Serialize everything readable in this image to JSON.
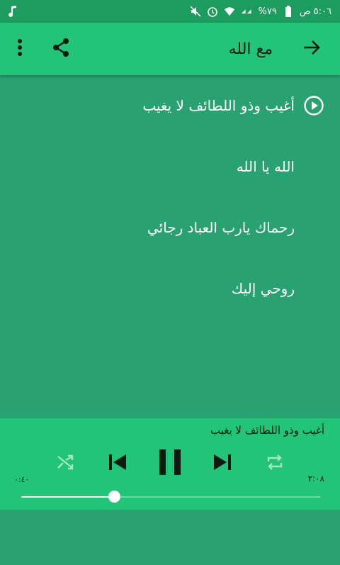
{
  "status_bar": {
    "time": "٥:٠٦ ص",
    "battery": "%٧٩",
    "icons": [
      "music-note-icon",
      "mute-icon",
      "alarm-icon",
      "wifi-icon",
      "signal-icon",
      "battery-icon"
    ]
  },
  "app_bar": {
    "title": "مع الله",
    "icons": [
      "overflow-menu-icon",
      "share-icon",
      "arrow-forward-icon"
    ]
  },
  "tracks": [
    {
      "title": "أغيب وذو اللطائف لا يغيب",
      "playing": true
    },
    {
      "title": "الله يا الله",
      "playing": false
    },
    {
      "title": "رحماك يارب العباد رجائي",
      "playing": false
    },
    {
      "title": "روحي إليك",
      "playing": false
    }
  ],
  "player": {
    "now_playing": "أغيب وذو اللطائف لا يغيب",
    "elapsed": "٠:٤٠",
    "duration": "٢:٠٨",
    "progress": 0.31,
    "controls": [
      "shuffle-icon",
      "previous-icon",
      "pause-icon",
      "next-icon",
      "repeat-icon"
    ]
  },
  "colors": {
    "status_bar": "#1d9c5f",
    "app_bar": "#22c477",
    "list_background": "#2aa171",
    "player_background": "#22c477"
  }
}
